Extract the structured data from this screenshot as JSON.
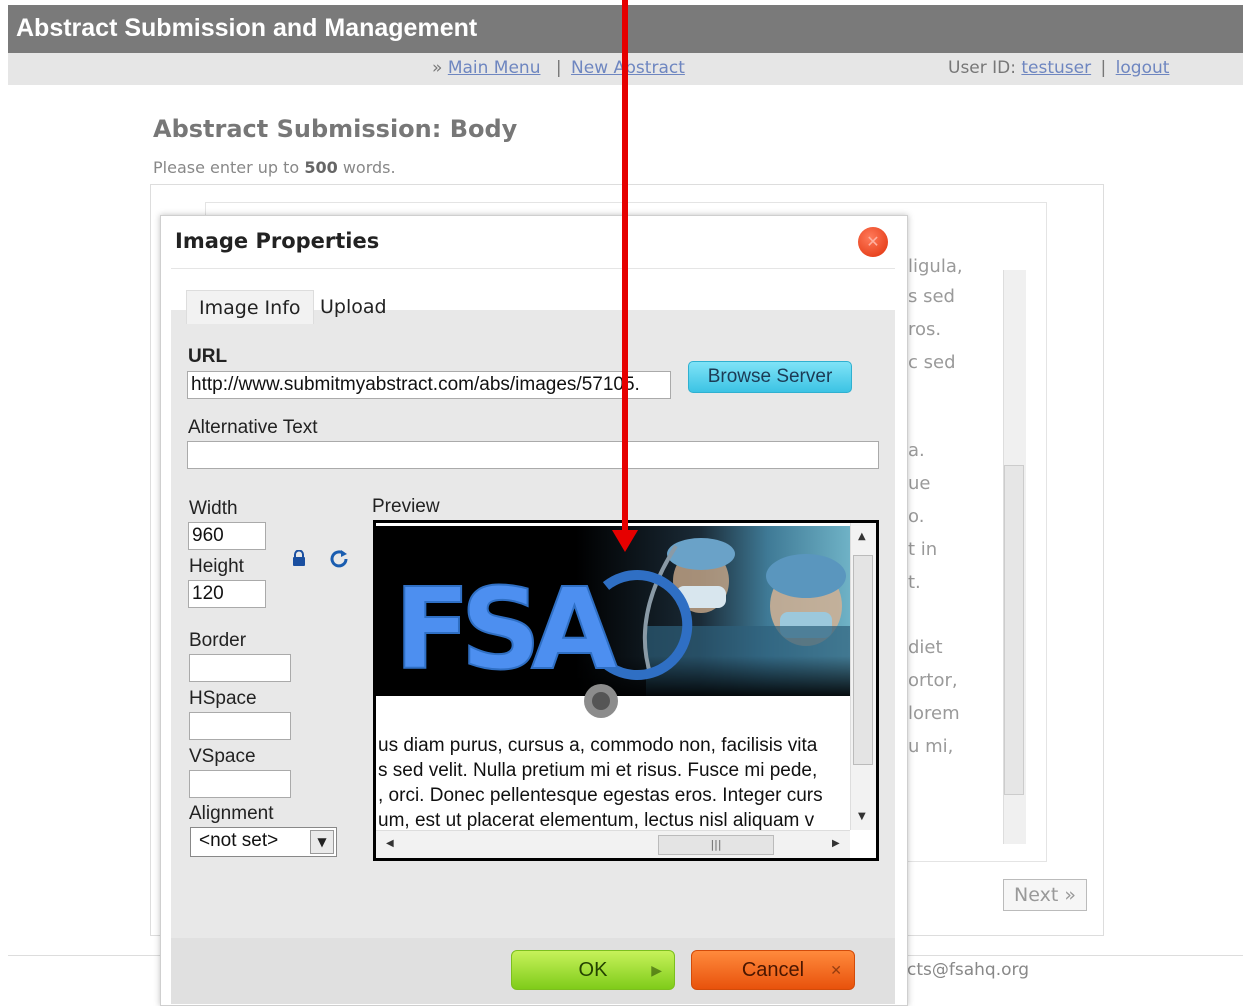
{
  "header": {
    "title": "Abstract Submission and Management",
    "nav_sep": "»",
    "main_menu": "Main Menu",
    "pipe": "|",
    "new_abstract": "New Abstract",
    "user_id_label": "User ID:",
    "user_id": "testuser",
    "logout": "logout"
  },
  "page": {
    "heading": "Abstract Submission: Body",
    "instructions_prefix": "Please enter up to",
    "word_limit": "500",
    "instructions_suffix": "words.",
    "background_text": [
      "ligula,",
      "s sed",
      "ros.",
      "c sed",
      "a.",
      "ue",
      "o.",
      "t in",
      "t.",
      "diet",
      "ortor,",
      "lorem",
      "u mi,"
    ],
    "next_button": "Next »",
    "footer_email_partial": "cts@fsahq.org"
  },
  "dialog": {
    "title": "Image Properties",
    "tabs": [
      {
        "label": "Image Info",
        "active": true
      },
      {
        "label": "Upload",
        "active": false
      }
    ],
    "url_label": "URL",
    "url_value": "http://www.submitmyabstract.com/abs/images/57105.",
    "browse_button": "Browse Server",
    "alt_label": "Alternative Text",
    "alt_value": "",
    "width_label": "Width",
    "width_value": "960",
    "height_label": "Height",
    "height_value": "120",
    "border_label": "Border",
    "border_value": "",
    "hspace_label": "HSpace",
    "hspace_value": "",
    "vspace_label": "VSpace",
    "vspace_value": "",
    "alignment_label": "Alignment",
    "alignment_value": "<not set>",
    "preview_label": "Preview",
    "preview_logo_text": "FSA",
    "preview_text_lines": [
      "us diam purus, cursus a, commodo non, facilisis vita",
      "s sed velit. Nulla pretium mi et risus. Fusce mi pede,",
      ", orci. Donec pellentesque egestas eros. Integer curs",
      "um, est ut placerat elementum, lectus nisl aliquam v"
    ],
    "ok_button": "OK",
    "cancel_button": "Cancel"
  },
  "colors": {
    "header_bg": "#7a7a7a",
    "link": "#6e86c0",
    "annotation_arrow": "#e60000",
    "ok_green": "#9ee03a",
    "cancel_orange": "#f06a1e",
    "browse_cyan": "#5dd4ee"
  }
}
